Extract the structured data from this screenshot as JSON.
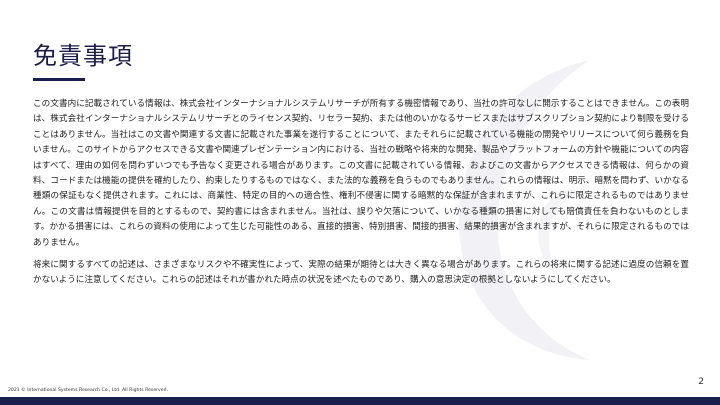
{
  "slide": {
    "title": "免責事項",
    "paragraphs": [
      "この文書内に記載されている情報は、株式会社インターナショナルシステムリサーチが所有する機密情報であり、当社の許可なしに開示することはできません。この表明は、株式会社インターナショナルシステムリサーチとのライセンス契約、リセラー契約、または他のいかなるサービスまたはサブスクリプション契約により制限を受けることはありません。当社はこの文書や関連する文書に記載された事業を遂行することについて、またそれらに記載されている機能の開発やリリースについて何ら義務を負いません。このサイトからアクセスできる文書や関連プレゼンテーション内における、当社の戦略や将来的な開発、製品やプラットフォームの方針や機能についての内容はすべて、理由の如何を問わずいつでも予告なく変更される場合があります。この文書に記載されている情報、およびこの文書からアクセスできる情報は、何らかの資料、コードまたは機能の提供を確約したり、約束したりするものではなく、また法的な義務を負うものでもありません。これらの情報は、明示、暗黙を問わず、いかなる種類の保証もなく提供されます。これには、商業性、特定の目的への適合性、権利不侵害に関する暗黙的な保証が含まれますが、これらに限定されるものではありません。この文書は情報提供を目的とするもので、契約書には含まれません。当社は、誤りや欠落について、いかなる種類の損害に対しても賠償責任を負わないものとします。かかる損害には、これらの資料の使用によって生じた可能性のある、直接的損害、特別損害、間接的損害、結果的損害が含まれますが、それらに限定されるものではありません。",
      "将来に関するすべての記述は、さまざまなリスクや不確実性によって、実際の結果が期待とは大きく異なる場合があります。これらの将来に関する記述に過度の信頼を置かないように注意してください。これらの記述はそれが書かれた時点の状況を述べたものであり、購入の意思決定の根拠としないようにしてください。"
    ],
    "page_number": "2",
    "copyright": "2021 © International Systems Research Co., Ltd. All Rights Reserved."
  },
  "colors": {
    "navy": "#1a1f4e",
    "watermark": "#f2f2f6"
  }
}
